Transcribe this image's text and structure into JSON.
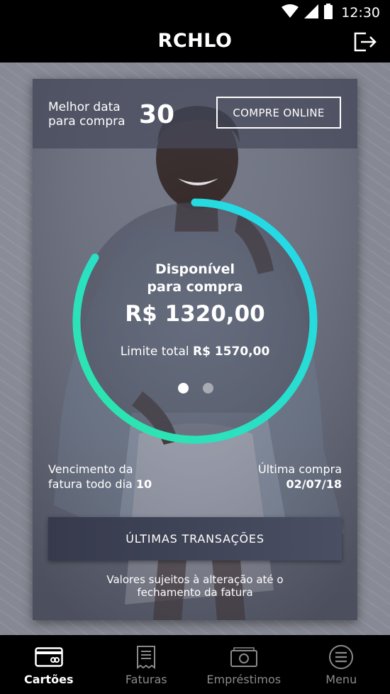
{
  "status_bar": {
    "time": "12:30"
  },
  "app_bar": {
    "title": "RCHLO"
  },
  "card": {
    "best_date_label_line1": "Melhor data",
    "best_date_label_line2": "para compra",
    "best_date_value": "30",
    "buy_online_label": "COMPRE ONLINE",
    "available_label_line1": "Disponível",
    "available_label_line2": "para compra",
    "available_value": "R$ 1320,00",
    "total_limit_label": "Limite total",
    "total_limit_value": "R$ 1570,00",
    "limit_used_fraction": 0.84,
    "page_count": 2,
    "active_page": 1,
    "due_label_line1": "Vencimento da",
    "due_label_line2": "fatura todo dia",
    "due_day": "10",
    "last_purchase_label": "Última compra",
    "last_purchase_date": "02/07/18",
    "transactions_label": "ÚLTIMAS TRANSAÇÕES",
    "disclaimer_line1": "Valores sujeitos à alteração até o",
    "disclaimer_line2": "fechamento da fatura"
  },
  "bottom_nav": {
    "items": [
      {
        "label": "Cartões",
        "icon": "credit-card-icon",
        "active": true
      },
      {
        "label": "Faturas",
        "icon": "receipt-icon",
        "active": false
      },
      {
        "label": "Empréstimos",
        "icon": "money-icon",
        "active": false
      },
      {
        "label": "Menu",
        "icon": "menu-icon",
        "active": false
      }
    ]
  },
  "colors": {
    "ring_start": "#2ee6a6",
    "ring_end": "#23d8f0",
    "nav_active": "#ffffff",
    "nav_inactive": "#8a8a8a"
  }
}
